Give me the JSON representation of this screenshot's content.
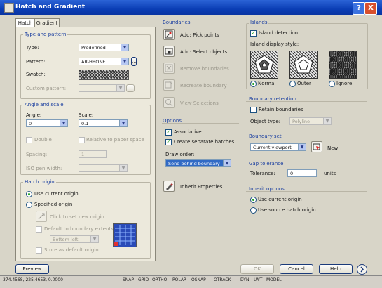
{
  "window": {
    "title": "Hatch and Gradient",
    "help_btn": "?",
    "close_btn": "X"
  },
  "tabs": [
    {
      "label": "Hatch"
    },
    {
      "label": "Gradient"
    }
  ],
  "type_pattern": {
    "title": "Type and pattern",
    "type_label": "Type:",
    "type_value": "Predefined",
    "pattern_label": "Pattern:",
    "pattern_value": "AR-HBONE",
    "swatch_label": "Swatch:",
    "custom_label": "Custom pattern:"
  },
  "angle_scale": {
    "title": "Angle and scale",
    "angle_label": "Angle:",
    "angle_value": "0",
    "scale_label": "Scale:",
    "scale_value": "0.1",
    "double_label": "Double",
    "relative_label": "Relative to paper space",
    "spacing_label": "Spacing:",
    "spacing_value": "1",
    "iso_label": "ISO pen width:"
  },
  "origin": {
    "title": "Hatch origin",
    "use_current": "Use current origin",
    "specified": "Specified origin",
    "click_set": "Click to set new origin",
    "default_extents": "Default to boundary extents",
    "extents_value": "Bottom left",
    "store_default": "Store as default origin"
  },
  "boundaries": {
    "title": "Boundaries",
    "add_pick": "Add: Pick points",
    "add_select": "Add: Select objects",
    "remove": "Remove boundaries",
    "recreate": "Recreate boundary",
    "view": "View Selections"
  },
  "options": {
    "title": "Options",
    "associative": "Associative",
    "separate": "Create separate hatches",
    "draw_order_label": "Draw order:",
    "draw_order_value": "Send behind boundary"
  },
  "inherit": {
    "label": "Inherit Properties"
  },
  "islands": {
    "title": "Islands",
    "detection": "Island detection",
    "style_label": "Island display style:",
    "normal": "Normal",
    "outer": "Outer",
    "ignore": "Ignore"
  },
  "retention": {
    "title": "Boundary retention",
    "retain": "Retain boundaries",
    "object_type_label": "Object type:",
    "object_type_value": "Polyline"
  },
  "boundary_set": {
    "title": "Boundary set",
    "value": "Current viewport",
    "new_label": "New"
  },
  "gap": {
    "title": "Gap tolerance",
    "label": "Tolerance:",
    "value": "0",
    "units": "units"
  },
  "inherit_options": {
    "title": "Inherit options",
    "use_current": "Use current origin",
    "use_source": "Use source hatch origin"
  },
  "footer": {
    "preview": "Preview",
    "ok": "OK",
    "cancel": "Cancel",
    "help": "Help"
  },
  "statusbar": {
    "coords": "374.4568, 225.4653, 0.0000",
    "toggles": [
      "SNAP",
      "GRID",
      "ORTHO",
      "POLAR",
      "OSNAP",
      "OTRACK",
      "DYN",
      "LWT",
      "MODEL"
    ]
  }
}
